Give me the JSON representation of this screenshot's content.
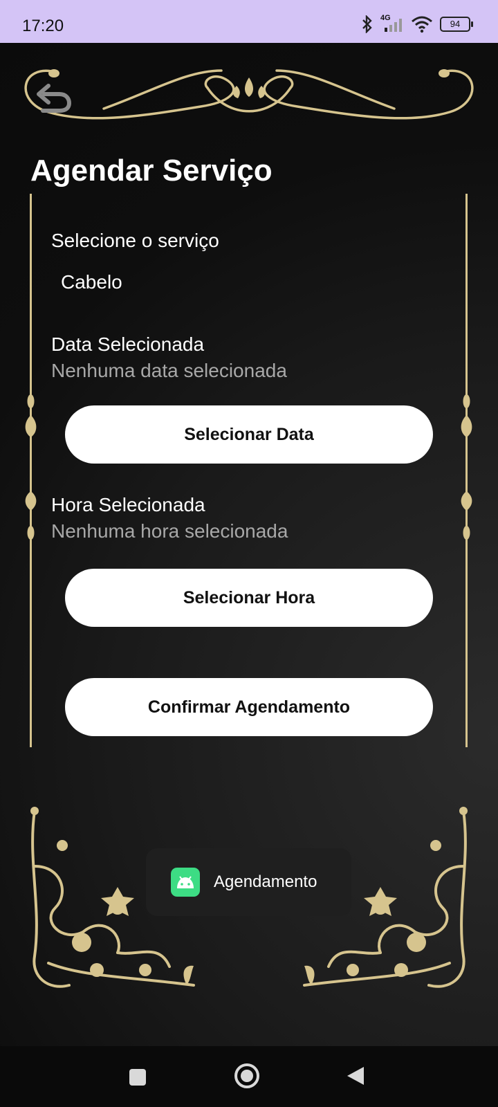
{
  "status_bar": {
    "time": "17:20",
    "network": "4G",
    "battery": "94"
  },
  "screen": {
    "title": "Agendar Serviço"
  },
  "service": {
    "label": "Selecione o serviço",
    "selected": "Cabelo"
  },
  "date": {
    "label": "Data Selecionada",
    "value": "Nenhuma data selecionada",
    "button": "Selecionar Data"
  },
  "time": {
    "label": "Hora Selecionada",
    "value": "Nenhuma hora selecionada",
    "button": "Selecionar Hora"
  },
  "confirm_button": "Confirmar Agendamento",
  "toast": {
    "icon": "android-icon",
    "text": "Agendamento"
  },
  "colors": {
    "status_bar": "#d4c4f6",
    "gold": "#d6c48e",
    "background": "#0b0b0b",
    "button": "#ffffff"
  }
}
